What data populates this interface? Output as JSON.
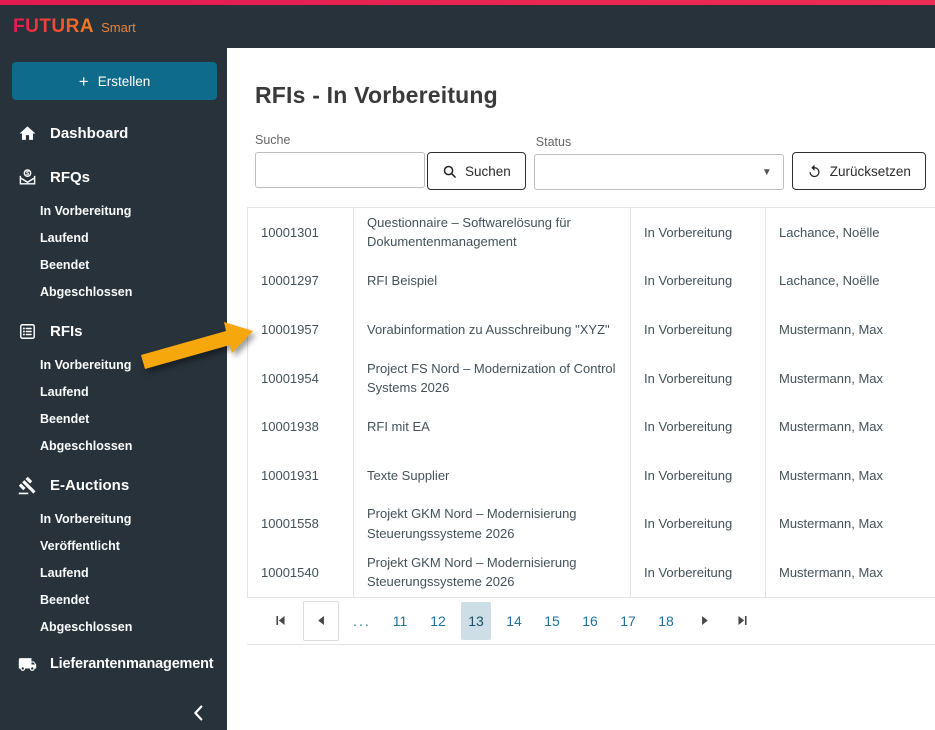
{
  "app": {
    "brand": "FUTURA",
    "brand_suffix": "Smart"
  },
  "colors": {
    "topbar_red": "#e8174f",
    "header_sidebar_dark": "#27323a",
    "primary_teal": "#0e6b8c",
    "link_blue": "#2073a0",
    "active_page_bg": "#cddee6",
    "annotation_arrow": "#f6a70b",
    "logo_gradient_start": "#e8174f",
    "logo_gradient_end": "#f2801e"
  },
  "icons": {
    "create": "plus-icon",
    "dashboard": "home-icon",
    "rfqs": "envelope-dollar-icon",
    "rfis": "list-icon",
    "eauctions": "gavel-icon",
    "suppliers": "truck-icon",
    "search": "magnifier-icon",
    "reset": "undo-arrow-icon",
    "status": "caret-down-icon",
    "collapse": "chevron-left-icon"
  },
  "sidebar": {
    "create_label": "Erstellen",
    "sections": [
      {
        "label": "Dashboard",
        "items": []
      },
      {
        "label": "RFQs",
        "items": [
          "In Vorbereitung",
          "Laufend",
          "Beendet",
          "Abgeschlossen"
        ]
      },
      {
        "label": "RFIs",
        "items": [
          "In Vorbereitung",
          "Laufend",
          "Beendet",
          "Abgeschlossen"
        ]
      },
      {
        "label": "E-Auctions",
        "items": [
          "In Vorbereitung",
          "Veröffentlicht",
          "Laufend",
          "Beendet",
          "Abgeschlossen"
        ]
      },
      {
        "label": "Lieferantenmanagement",
        "items": []
      }
    ]
  },
  "main": {
    "title": "RFIs -  In Vorbereitung",
    "filters": {
      "search_label": "Suche",
      "search_value": "",
      "search_button": "Suchen",
      "status_label": "Status",
      "status_value": "",
      "reset_button": "Zurücksetzen"
    },
    "table": {
      "rows": [
        {
          "id": "10001301",
          "description": "Questionnaire – Softwarelösung für Dokumentenmanagement",
          "status": "In Vorbereitung",
          "owner": "Lachance, Noëlle"
        },
        {
          "id": "10001297",
          "description": "RFI Beispiel",
          "status": "In Vorbereitung",
          "owner": "Lachance, Noëlle"
        },
        {
          "id": "10001957",
          "description": "Vorabinformation zu Ausschreibung \"XYZ\"",
          "status": "In Vorbereitung",
          "owner": "Mustermann, Max"
        },
        {
          "id": "10001954",
          "description": "Project FS Nord – Modernization of Control Systems 2026",
          "status": "In Vorbereitung",
          "owner": "Mustermann, Max"
        },
        {
          "id": "10001938",
          "description": "RFI mit EA",
          "status": "In Vorbereitung",
          "owner": "Mustermann, Max"
        },
        {
          "id": "10001931",
          "description": "Texte Supplier",
          "status": "In Vorbereitung",
          "owner": "Mustermann, Max"
        },
        {
          "id": "10001558",
          "description": "Projekt GKM Nord – Modernisierung Steuerungssysteme 2026",
          "status": "In Vorbereitung",
          "owner": "Mustermann, Max"
        },
        {
          "id": "10001540",
          "description": "Projekt GKM Nord – Modernisierung Steuerungssysteme 2026",
          "status": "In Vorbereitung",
          "owner": "Mustermann, Max"
        }
      ]
    },
    "pagination": {
      "ellipsis": "...",
      "pages": [
        "11",
        "12",
        "13",
        "14",
        "15",
        "16",
        "17",
        "18"
      ],
      "active_page": "13"
    }
  }
}
